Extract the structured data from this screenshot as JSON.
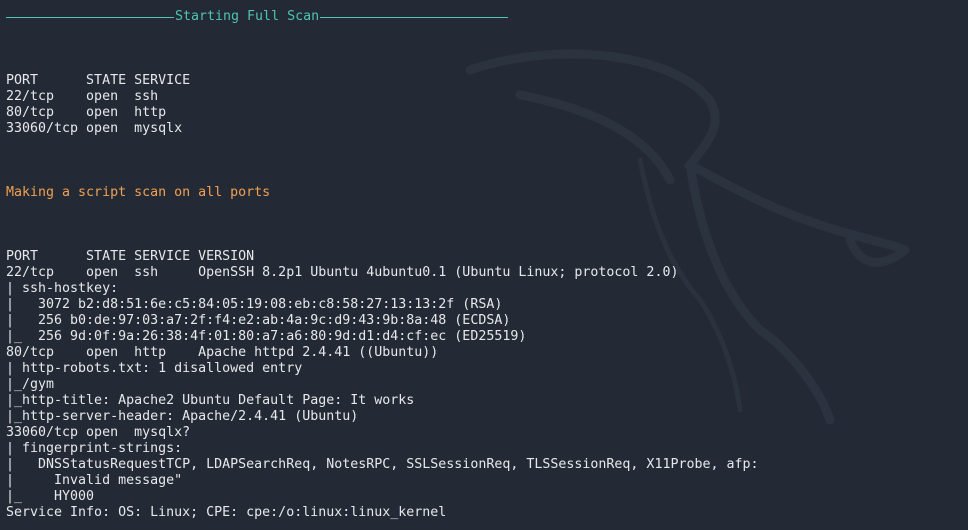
{
  "theme": {
    "background": "#232a36",
    "text": "#e8e8ea",
    "header_accent": "#4fc3b4",
    "message_accent": "#f0a050"
  },
  "terminal": {
    "header_title": "Starting Full Scan",
    "table1": {
      "header": "PORT      STATE SERVICE",
      "rows": [
        "22/tcp    open  ssh",
        "80/tcp    open  http",
        "33060/tcp open  mysqlx"
      ]
    },
    "message": "Making a script scan on all ports",
    "table2": {
      "header": "PORT      STATE SERVICE VERSION",
      "lines": [
        "22/tcp    open  ssh     OpenSSH 8.2p1 Ubuntu 4ubuntu0.1 (Ubuntu Linux; protocol 2.0)",
        "| ssh-hostkey:",
        "|   3072 b2:d8:51:6e:c5:84:05:19:08:eb:c8:58:27:13:13:2f (RSA)",
        "|   256 b0:de:97:03:a7:2f:f4:e2:ab:4a:9c:d9:43:9b:8a:48 (ECDSA)",
        "|_  256 9d:0f:9a:26:38:4f:01:80:a7:a6:80:9d:d1:d4:cf:ec (ED25519)",
        "80/tcp    open  http    Apache httpd 2.4.41 ((Ubuntu))",
        "| http-robots.txt: 1 disallowed entry",
        "|_/gym",
        "|_http-title: Apache2 Ubuntu Default Page: It works",
        "|_http-server-header: Apache/2.4.41 (Ubuntu)",
        "33060/tcp open  mysqlx?",
        "| fingerprint-strings:",
        "|   DNSStatusRequestTCP, LDAPSearchReq, NotesRPC, SSLSessionReq, TLSSessionReq, X11Probe, afp:",
        "|     Invalid message\"",
        "|_    HY000",
        "Service Info: OS: Linux; CPE: cpe:/o:linux:linux_kernel"
      ]
    }
  }
}
